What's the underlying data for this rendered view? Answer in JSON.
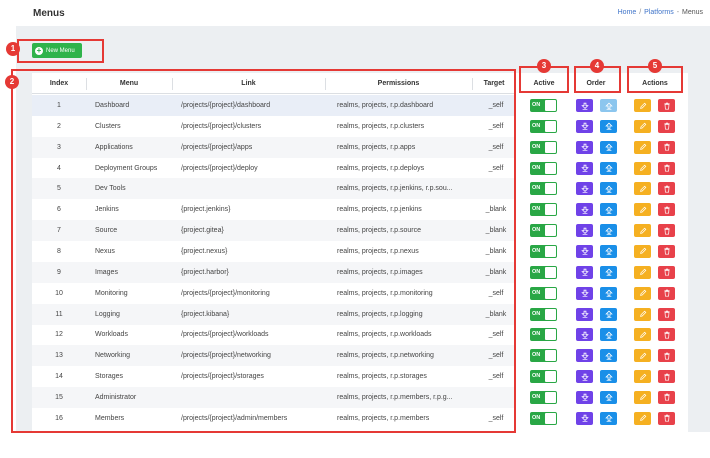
{
  "header": {
    "title": "Menus",
    "breadcrumb": [
      {
        "label": "Home"
      },
      {
        "label": "Platforms"
      },
      {
        "label": "Menus"
      }
    ],
    "breadcrumb_separator": "/",
    "breadcrumb_trailing_separator": "-"
  },
  "toolbar": {
    "new_menu_label": "New Menu",
    "new_menu_icon": "plus-circle-icon"
  },
  "table": {
    "columns": [
      "Index",
      "Menu",
      "Link",
      "Permissions",
      "Target"
    ],
    "rows": [
      {
        "index": "1",
        "menu": "Dashboard",
        "link": "/projects/{project}/dashboard",
        "permissions": "realms, projects, r.p.dashboard",
        "target": "_self"
      },
      {
        "index": "2",
        "menu": "Clusters",
        "link": "/projects/{project}/clusters",
        "permissions": "realms, projects, r.p.clusters",
        "target": "_self"
      },
      {
        "index": "3",
        "menu": "Applications",
        "link": "/projects/{project}/apps",
        "permissions": "realms, projects, r.p.apps",
        "target": "_self"
      },
      {
        "index": "4",
        "menu": "Deployment Groups",
        "link": "/projects/{project}/deploy",
        "permissions": "realms, projects, r.p.deploys",
        "target": "_self"
      },
      {
        "index": "5",
        "menu": "Dev Tools",
        "link": "",
        "permissions": "realms, projects, r.p.jenkins, r.p.sou...",
        "target": ""
      },
      {
        "index": "6",
        "menu": "Jenkins",
        "link": "{project.jenkins}",
        "permissions": "realms, projects, r.p.jenkins",
        "target": "_blank"
      },
      {
        "index": "7",
        "menu": "Source",
        "link": "{project.gitea}",
        "permissions": "realms, projects, r.p.source",
        "target": "_blank"
      },
      {
        "index": "8",
        "menu": "Nexus",
        "link": "{project.nexus}",
        "permissions": "realms, projects, r.p.nexus",
        "target": "_blank"
      },
      {
        "index": "9",
        "menu": "Images",
        "link": "{project.harbor}",
        "permissions": "realms, projects, r.p.images",
        "target": "_blank"
      },
      {
        "index": "10",
        "menu": "Monitoring",
        "link": "/projects/{project}/monitoring",
        "permissions": "realms, projects, r.p.monitoring",
        "target": "_self"
      },
      {
        "index": "11",
        "menu": "Logging",
        "link": "{project.kibana}",
        "permissions": "realms, projects, r.p.logging",
        "target": "_blank"
      },
      {
        "index": "12",
        "menu": "Workloads",
        "link": "/projects/{project}/workloads",
        "permissions": "realms, projects, r.p.workloads",
        "target": "_self"
      },
      {
        "index": "13",
        "menu": "Networking",
        "link": "/projects/{project}/networking",
        "permissions": "realms, projects, r.p.networking",
        "target": "_self"
      },
      {
        "index": "14",
        "menu": "Storages",
        "link": "/projects/{project}/storages",
        "permissions": "realms, projects, r.p.storages",
        "target": "_self"
      },
      {
        "index": "15",
        "menu": "Administrator",
        "link": "",
        "permissions": "realms, projects, r.p.members, r.p.g...",
        "target": ""
      },
      {
        "index": "16",
        "menu": "Members",
        "link": "/projects/{project}/admin/members",
        "permissions": "realms, projects, r.p.members",
        "target": "_self"
      }
    ]
  },
  "active": {
    "header": "Active",
    "toggle_label": "ON"
  },
  "order": {
    "header": "Order",
    "down_icon": "arrow-down-icon",
    "up_icon": "arrow-up-icon"
  },
  "actions": {
    "header": "Actions",
    "edit_icon": "pencil-icon",
    "delete_icon": "trash-icon"
  },
  "annotations": [
    "1",
    "2",
    "3",
    "4",
    "5"
  ],
  "colors": {
    "accent_green": "#2fb34b",
    "toggle_green": "#29a745",
    "order_down": "#6f42e8",
    "order_up": "#1a8fe8",
    "edit": "#f5b021",
    "delete": "#e8414a",
    "annotation_red": "#e53935"
  }
}
